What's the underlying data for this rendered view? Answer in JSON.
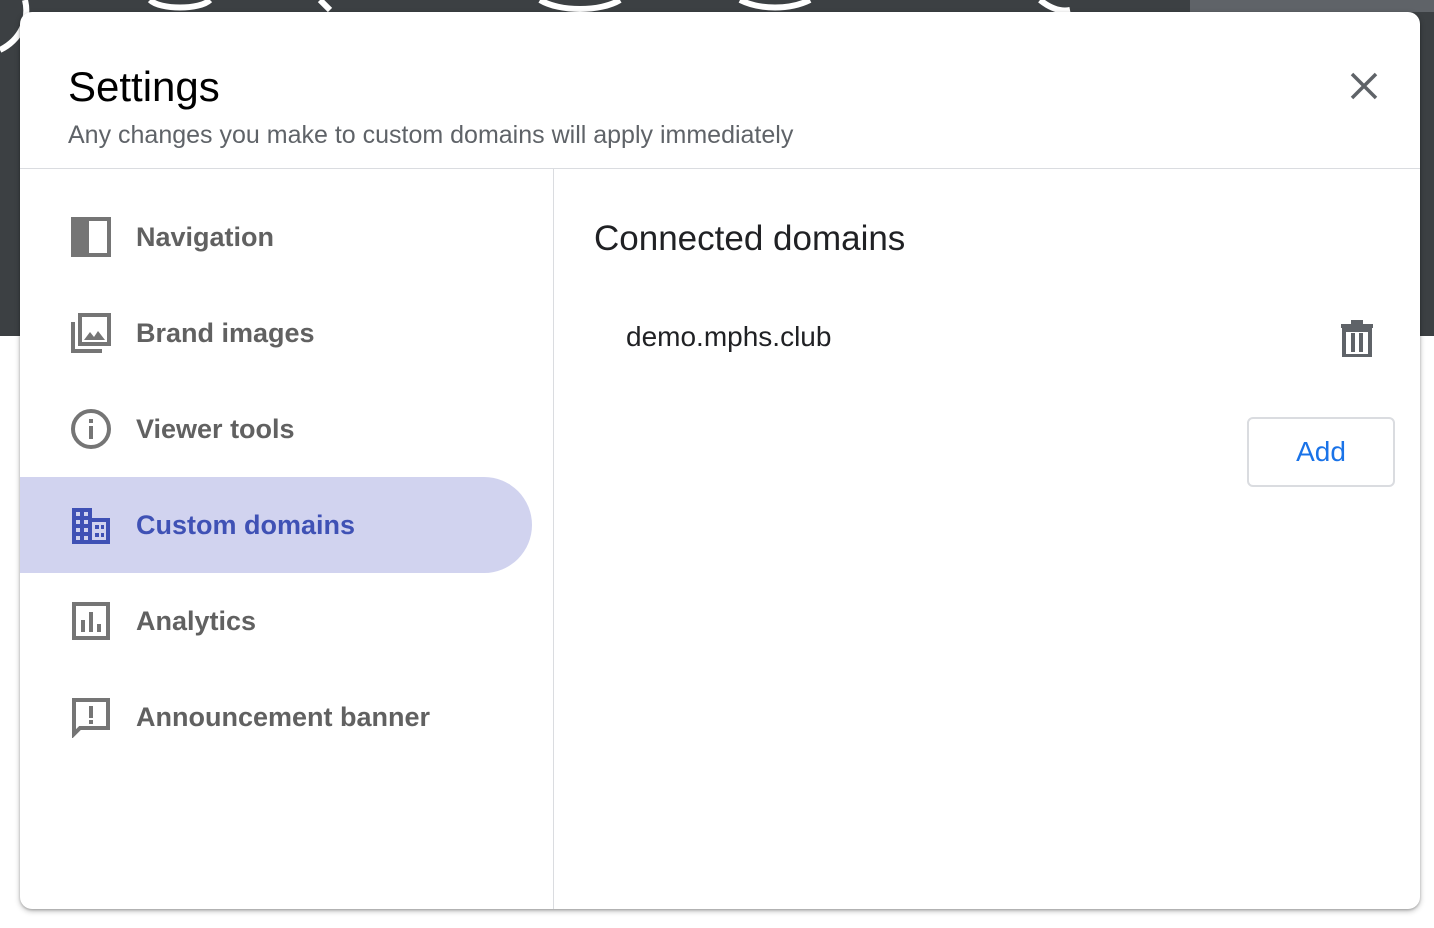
{
  "dialog": {
    "title": "Settings",
    "subtitle": "Any changes you make to custom domains will apply immediately",
    "close_icon": "close-icon"
  },
  "sidebar": {
    "items": [
      {
        "label": "Navigation",
        "icon": "navigation-panel-icon",
        "active": false
      },
      {
        "label": "Brand images",
        "icon": "photo-library-icon",
        "active": false
      },
      {
        "label": "Viewer tools",
        "icon": "info-icon",
        "active": false
      },
      {
        "label": "Custom domains",
        "icon": "domain-building-icon",
        "active": true
      },
      {
        "label": "Analytics",
        "icon": "bar-chart-icon",
        "active": false
      },
      {
        "label": "Announcement banner",
        "icon": "announcement-icon",
        "active": false
      }
    ]
  },
  "main": {
    "section_title": "Connected domains",
    "domains": [
      {
        "name": "demo.mphs.club",
        "delete_icon": "trash-icon"
      }
    ],
    "add_label": "Add"
  },
  "colors": {
    "accent": "#3f51b5",
    "active_bg": "#d1d3ef",
    "link_blue": "#1a73e8",
    "icon_gray": "#757575"
  }
}
